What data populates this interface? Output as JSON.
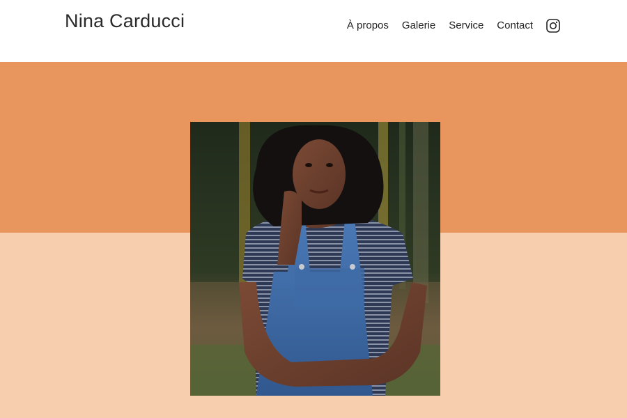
{
  "site": {
    "brand": "Nina Carducci"
  },
  "nav": {
    "items": [
      {
        "label": "À propos"
      },
      {
        "label": "Galerie"
      },
      {
        "label": "Service"
      },
      {
        "label": "Contact"
      }
    ],
    "social_icon": "instagram-icon"
  },
  "colors": {
    "band_top": "#E8955E",
    "band_bottom": "#F7CEAE",
    "header_bg": "#FFFFFF",
    "text": "#222222"
  },
  "hero": {
    "image": "portrait-photo"
  }
}
